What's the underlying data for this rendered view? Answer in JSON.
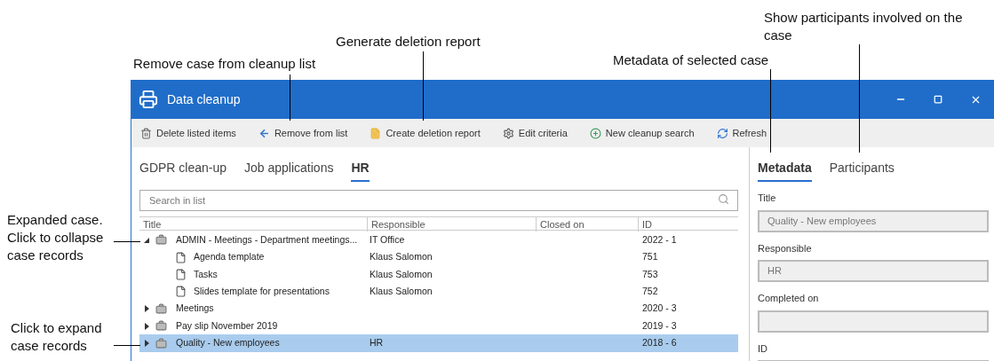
{
  "callouts": [
    {
      "text": "Show participants involved on the case"
    },
    {
      "text": "Generate deletion report"
    },
    {
      "text": "Remove case from cleanup list"
    },
    {
      "text": "Metadata of selected case"
    },
    {
      "text": "Expanded case. Click to collapse case records"
    },
    {
      "text": "Click to expand case records"
    }
  ],
  "window": {
    "title": "Data cleanup"
  },
  "toolbar": [
    {
      "label": "Delete listed items"
    },
    {
      "label": "Remove from list"
    },
    {
      "label": "Create deletion report"
    },
    {
      "label": "Edit criteria"
    },
    {
      "label": "New cleanup search"
    },
    {
      "label": "Refresh"
    }
  ],
  "tabs": [
    {
      "label": "GDPR clean-up",
      "selected": false
    },
    {
      "label": "Job applications",
      "selected": false
    },
    {
      "label": "HR",
      "selected": true
    }
  ],
  "search": {
    "placeholder": "Search in list"
  },
  "table": {
    "columns": [
      "Title",
      "Responsible",
      "Closed on",
      "ID"
    ],
    "rows": [
      {
        "title": "ADMIN - Meetings - Department meetings...",
        "responsible": "IT Office",
        "id": "2022 - 1",
        "expanded": true,
        "selected": false,
        "children": [
          {
            "title": "Agenda template",
            "responsible": "Klaus Salomon",
            "id": "751",
            "selected": false
          },
          {
            "title": "Tasks",
            "responsible": "Klaus Salomon",
            "id": "753",
            "selected": false
          },
          {
            "title": "Slides template for presentations",
            "responsible": "Klaus Salomon",
            "id": "752",
            "selected": false
          }
        ]
      },
      {
        "title": "Meetings",
        "id": "2020 - 3",
        "expanded": false,
        "selected": false
      },
      {
        "title": "Pay slip November 2019",
        "id": "2019 - 3",
        "expanded": false,
        "selected": false
      },
      {
        "title": "Quality - New employees",
        "responsible": "HR",
        "id": "2018 - 6",
        "expanded": false,
        "selected": true
      }
    ]
  },
  "details": {
    "tabs": [
      {
        "label": "Metadata",
        "selected": true
      },
      {
        "label": "Participants",
        "selected": false
      }
    ],
    "fields": [
      {
        "label": "Title",
        "value": "Quality - New employees"
      },
      {
        "label": "Responsible",
        "value": "HR"
      },
      {
        "label": "Completed on"
      },
      {
        "label": "ID"
      }
    ]
  }
}
